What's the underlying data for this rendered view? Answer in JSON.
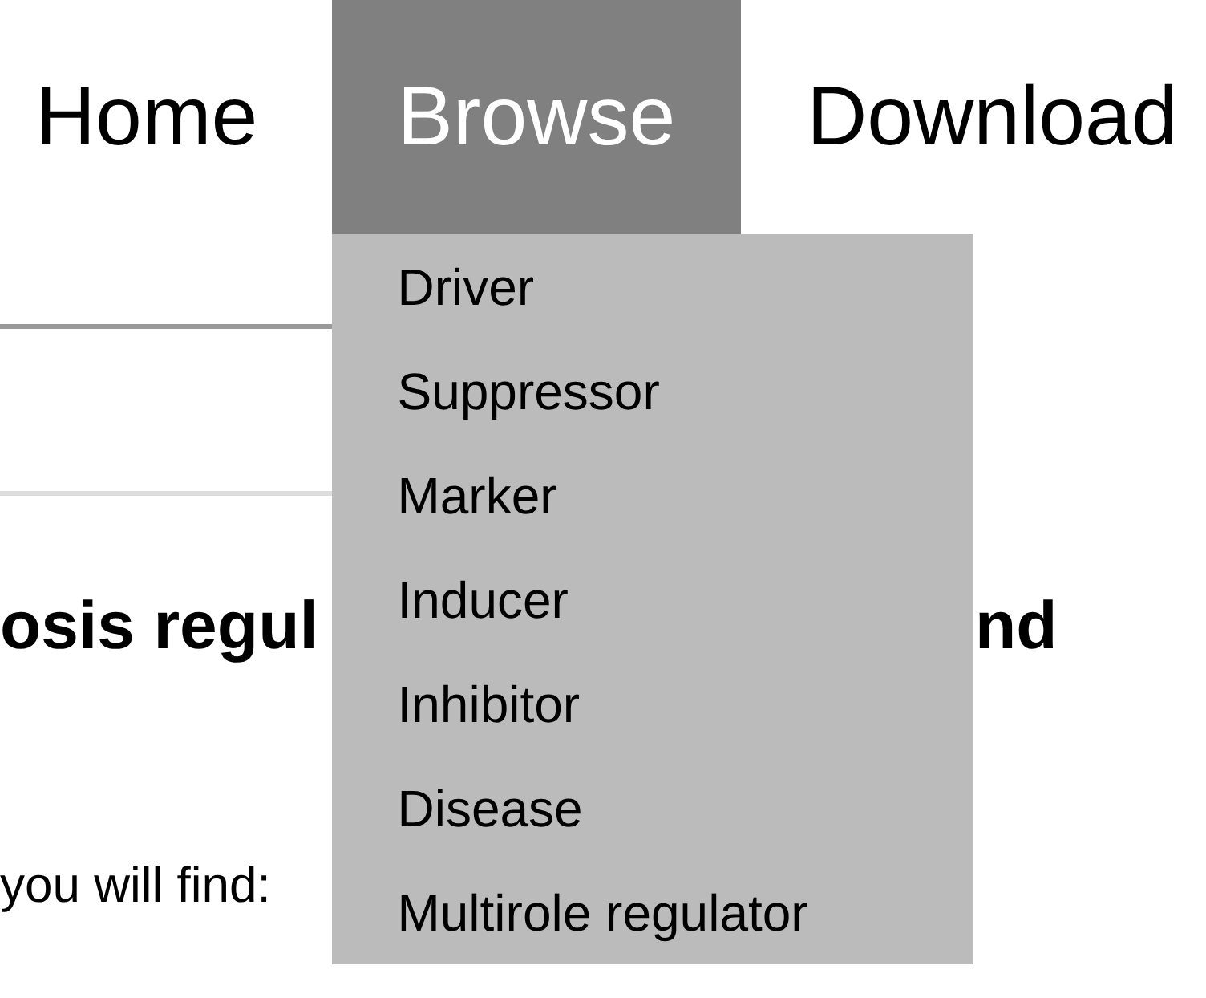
{
  "nav": {
    "items": [
      {
        "label": "Home",
        "selected": false
      },
      {
        "label": "Browse",
        "selected": true,
        "expanded": true,
        "menu": [
          "Driver",
          "Suppressor",
          "Marker",
          "Inducer",
          "Inhibitor",
          "Disease",
          "Multirole regulator"
        ]
      },
      {
        "label": "Download",
        "selected": false
      }
    ]
  },
  "heading": {
    "visible_start": "osis regul",
    "visible_end": "nd"
  },
  "intro": "you will find:"
}
